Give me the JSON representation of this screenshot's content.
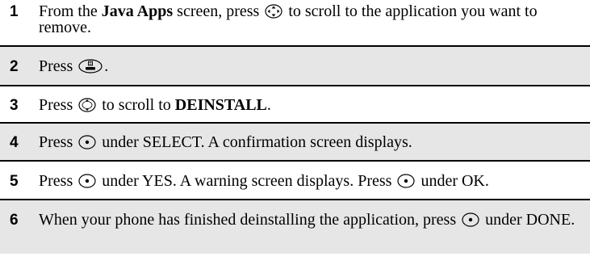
{
  "steps": [
    {
      "number": "1",
      "parts": [
        {
          "t": "text",
          "v": "From the "
        },
        {
          "t": "bold",
          "v": "Java Apps"
        },
        {
          "t": "text",
          "v": " screen, press "
        },
        {
          "t": "icon",
          "v": "nav-scroll-4way-icon"
        },
        {
          "t": "text",
          "v": " to scroll to the application you want to remove."
        }
      ]
    },
    {
      "number": "2",
      "parts": [
        {
          "t": "text",
          "v": "Press "
        },
        {
          "t": "icon",
          "v": "menu-key-icon"
        },
        {
          "t": "text",
          "v": "."
        }
      ]
    },
    {
      "number": "3",
      "parts": [
        {
          "t": "text",
          "v": "Press "
        },
        {
          "t": "icon",
          "v": "nav-scroll-updown-icon"
        },
        {
          "t": "text",
          "v": " to scroll to "
        },
        {
          "t": "bold",
          "v": "DEINSTALL"
        },
        {
          "t": "text",
          "v": "."
        }
      ]
    },
    {
      "number": "4",
      "parts": [
        {
          "t": "text",
          "v": "Press "
        },
        {
          "t": "icon",
          "v": "select-key-icon"
        },
        {
          "t": "text",
          "v": " under SELECT. A confirmation screen displays."
        }
      ]
    },
    {
      "number": "5",
      "parts": [
        {
          "t": "text",
          "v": "Press "
        },
        {
          "t": "icon",
          "v": "select-key-icon"
        },
        {
          "t": "text",
          "v": " under YES. A warning screen displays. Press "
        },
        {
          "t": "icon",
          "v": "select-key-icon"
        },
        {
          "t": "text",
          "v": " under OK."
        }
      ]
    },
    {
      "number": "6",
      "parts": [
        {
          "t": "text",
          "v": "When your phone has finished deinstalling the application, press "
        },
        {
          "t": "icon",
          "v": "select-key-icon"
        },
        {
          "t": "text",
          "v": " under DONE."
        }
      ]
    }
  ]
}
